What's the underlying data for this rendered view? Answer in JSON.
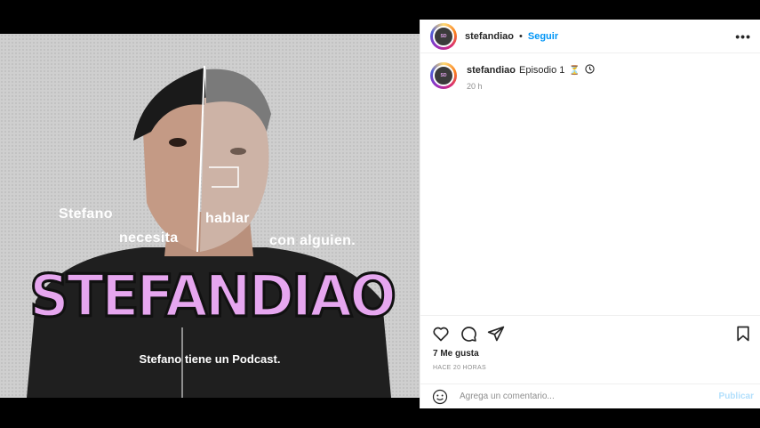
{
  "post": {
    "image": {
      "overlay_words": [
        "Stefano",
        "necesita",
        "hablar",
        "con alguien."
      ],
      "title": "STEFANDIAO",
      "subtitle": "Stefano tiene un Podcast."
    },
    "author": {
      "username": "stefandiao",
      "separator": "•",
      "follow_label": "Seguir",
      "more_label": "•••"
    },
    "caption": {
      "username": "stefandiao",
      "text": "Episodio 1",
      "emoji": "⏳",
      "time": "20 h"
    },
    "likes": "7 Me gusta",
    "posted_ago": "HACE 20 HORAS",
    "comment": {
      "placeholder": "Agrega un comentario...",
      "publish_label": "Publicar"
    },
    "colors": {
      "accent": "#0095f6",
      "publish_disabled": "#b2dffc",
      "title_pink": "#e6a6ef"
    },
    "icons": [
      "heart-icon",
      "comment-icon",
      "share-icon",
      "bookmark-icon",
      "emoji-icon",
      "clock-icon"
    ]
  }
}
